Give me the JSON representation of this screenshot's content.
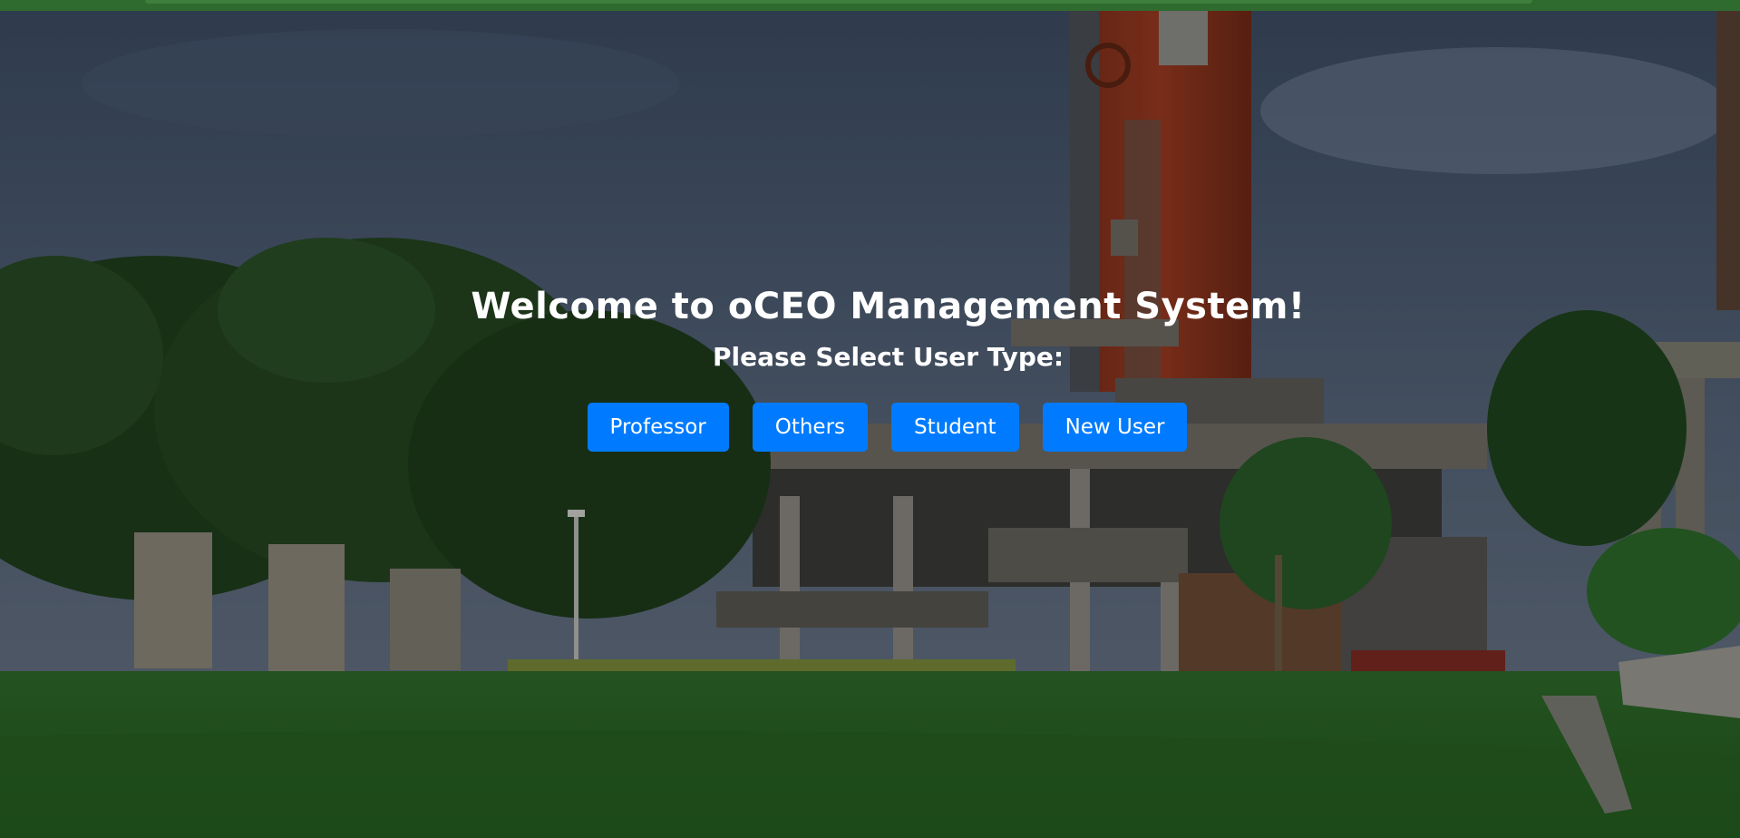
{
  "page": {
    "title": "Welcome to oCEO Management System!",
    "subtitle": "Please Select User Type:"
  },
  "user_types": {
    "professor_label": "Professor",
    "others_label": "Others",
    "student_label": "Student",
    "new_user_label": "New User"
  },
  "colors": {
    "button": "#007bff",
    "top_bar": "#2f6b2f",
    "text": "#ffffff"
  }
}
